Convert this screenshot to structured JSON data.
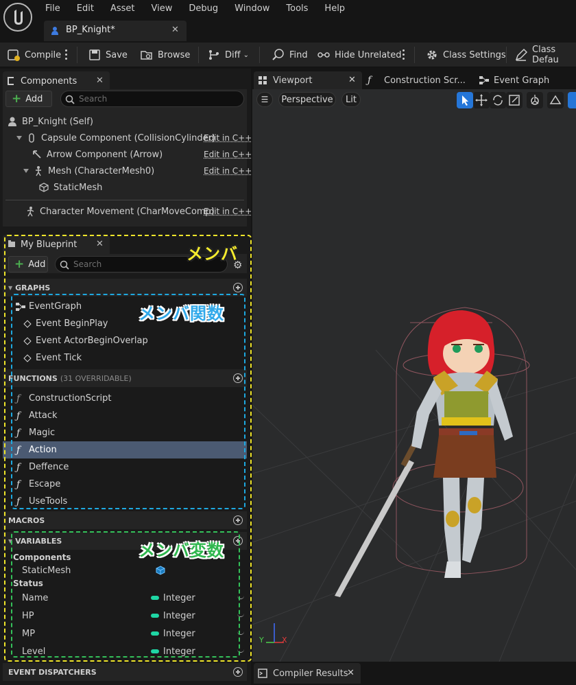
{
  "menu": [
    "File",
    "Edit",
    "Asset",
    "View",
    "Debug",
    "Window",
    "Tools",
    "Help"
  ],
  "document_tab": "BP_Knight*",
  "toolbar": {
    "compile": "Compile",
    "save": "Save",
    "browse": "Browse",
    "diff": "Diff",
    "find": "Find",
    "hide_unrelated": "Hide Unrelated",
    "class_settings": "Class Settings",
    "class_defaults": "Class Defau"
  },
  "components_panel": {
    "title": "Components",
    "add": "Add",
    "search_placeholder": "Search",
    "edit_cpp": "Edit in C++",
    "items": [
      {
        "label": "BP_Knight (Self)"
      },
      {
        "label": "Capsule Component (CollisionCylinder)"
      },
      {
        "label": "Arrow Component (Arrow)"
      },
      {
        "label": "Mesh (CharacterMesh0)"
      },
      {
        "label": "StaticMesh"
      },
      {
        "label": "Character Movement (CharMoveComp)"
      }
    ]
  },
  "my_blueprint": {
    "title": "My Blueprint",
    "add": "Add",
    "search_placeholder": "Search",
    "graphs_header": "GRAPHS",
    "graphs": [
      "EventGraph",
      "Event BeginPlay",
      "Event ActorBeginOverlap",
      "Event Tick"
    ],
    "functions_header": "FUNCTIONS",
    "functions_sub": "(31 OVERRIDABLE)",
    "functions": [
      "ConstructionScript",
      "Attack",
      "Magic",
      "Action",
      "Deffence",
      "Escape",
      "UseTools"
    ],
    "macros_header": "MACROS",
    "variables_header": "VARIABLES",
    "var_cat_components": "Components",
    "var_static_mesh": "StaticMesh",
    "var_cat_status": "Status",
    "variables": [
      {
        "name": "Name",
        "type": "Integer"
      },
      {
        "name": "HP",
        "type": "Integer"
      },
      {
        "name": "MP",
        "type": "Integer"
      },
      {
        "name": "Level",
        "type": "Integer"
      }
    ],
    "event_dispatchers_header": "EVENT DISPATCHERS"
  },
  "annotations": {
    "members": "メンバ",
    "member_functions": "メンバ関数",
    "member_variables": "メンバ変数"
  },
  "editor_tabs": {
    "viewport": "Viewport",
    "construction": "Construction Scr...",
    "event_graph": "Event Graph"
  },
  "viewport": {
    "perspective": "Perspective",
    "lit": "Lit",
    "axis_y": "Y",
    "axis_x": "X"
  },
  "bottom_tab": "Compiler Results",
  "colors": {
    "selected_row": "#4b5a72",
    "integer_pin": "#1fd6a4",
    "annotation_yellow": "#f0e62a",
    "annotation_blue": "#1ea9e0",
    "annotation_green": "#34c15a"
  }
}
